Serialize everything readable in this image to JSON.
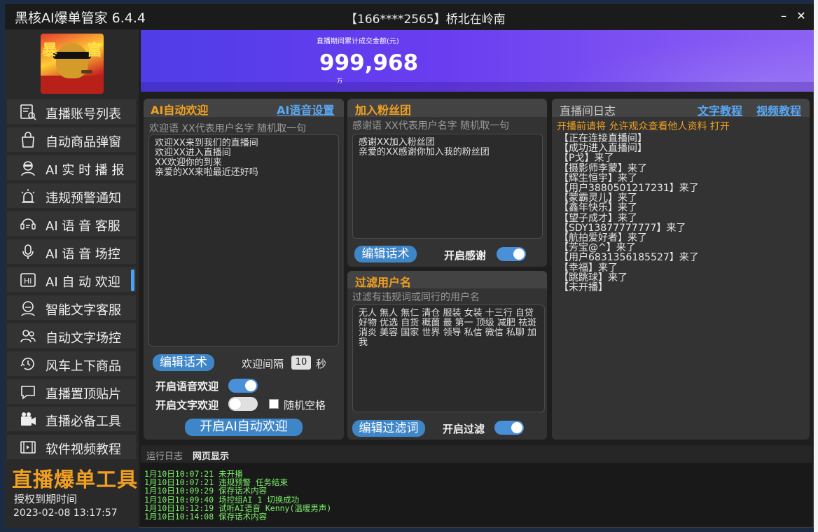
{
  "window": {
    "app_title": "黑核AI爆单管家 6.4.4",
    "user_info": "【166****2565】桥北在岭南",
    "minimize_label": "–",
    "close_label": "✕"
  },
  "sidebar": {
    "avatar_chars": [
      "暴",
      "富"
    ],
    "items": [
      {
        "label": "直播账号列表",
        "icon": "account-list-icon"
      },
      {
        "label": "自动商品弹窗",
        "icon": "shopping-bag-icon"
      },
      {
        "label": "AI 实 时 播 报",
        "icon": "broadcaster-icon"
      },
      {
        "label": "违规预警通知",
        "icon": "alarm-icon"
      },
      {
        "label": "AI 语 音 客服",
        "icon": "voice-service-icon"
      },
      {
        "label": "AI 语 音 场控",
        "icon": "microphone-icon"
      },
      {
        "label": "AI 自 动 欢迎",
        "icon": "hi-icon"
      },
      {
        "label": "智能文字客服",
        "icon": "text-service-icon"
      },
      {
        "label": "自动文字场控",
        "icon": "users-icon"
      },
      {
        "label": "风车上下商品",
        "icon": "windmill-icon"
      },
      {
        "label": "直播置顶贴片",
        "icon": "pin-message-icon"
      },
      {
        "label": "直播必备工具",
        "icon": "camera-tool-icon"
      },
      {
        "label": "软件视频教程",
        "icon": "video-tutorial-icon"
      }
    ],
    "active_index": 6,
    "brand": "直播爆单工具",
    "auth_label": "授权到期时间",
    "auth_date": "2023-02-08 13:17:57"
  },
  "banner": {
    "caption": "直播期间累计成交金额(元)",
    "amount": "999,968",
    "unit": "万"
  },
  "welcome_panel": {
    "title": "AI自动欢迎",
    "voice_link": "AI语音设置",
    "hint": "欢迎语  XX代表用户名字  随机取一句",
    "text": "欢迎XX来到我们的直播间\n欢迎XX进入直播间\nXX欢迎你的到来\n亲爱的XX来啦最近还好吗",
    "edit_button": "编辑话术",
    "interval_label": "欢迎间隔",
    "interval_value": "10",
    "interval_unit": "秒",
    "voice_toggle_label": "开启语音欢迎",
    "voice_toggle_on": true,
    "text_toggle_label": "开启文字欢迎",
    "text_toggle_on": false,
    "random_space_label": "随机空格",
    "start_button": "开启AI自动欢迎"
  },
  "fan_panel": {
    "title": "加入粉丝团",
    "hint": "感谢语  XX代表用户名字  随机取一句",
    "text": "感谢XX加入粉丝团\n亲爱的XX感谢你加入我的粉丝团",
    "edit_button": "编辑话术",
    "thanks_toggle_label": "开启感谢",
    "thanks_toggle_on": true
  },
  "filter_panel": {
    "title": "过滤用户名",
    "hint": "过滤有违规词或同行的用户名",
    "text": "无人 無人 無仁 清仓 服装 女装 十三行 自贷 好物 优选 自货 穊薗 最 第一 顶级 减肥 祛斑 消炎 美容 国家 世界 领导 私信 微信 私聊 加我",
    "edit_button": "编辑过滤词",
    "filter_toggle_label": "开启过滤",
    "filter_toggle_on": true
  },
  "log_panel": {
    "title": "直播间日志",
    "text_tutorial": "文字教程",
    "video_tutorial": "视频教程",
    "warning": "开播前请将 允许观众查看他人资料 打开",
    "lines": [
      "【正在连接直播间】",
      "【成功进入直播间】",
      "【P戈】来了",
      "【摄影师李蒙】来了",
      "【辉生恒宇】来了",
      "【用户3880501217231】来了",
      "【蒙霸灵儿】来了",
      "【鑫年快乐】来了",
      "【望子成才】来了",
      "【SDY13877777777】来了",
      "【航拍爱好者】来了",
      "【芳宝@^】来了",
      "【用户6831356185527】来了",
      "【幸福】来了",
      "【跳跳球】来了",
      "【未开播】"
    ]
  },
  "bottom": {
    "tab_run_log": "运行日志",
    "tab_web": "网页显示",
    "run_lines": [
      "1月10日10:07:21 未开播",
      "1月10日10:07:21 违规预警 任务结束",
      "1月10日10:09:29 保存话术内容",
      "1月10日10:09:40 场控组AI 1 切换成功",
      "1月10日10:12:19 试听AI语音 Kenny(温暖男声)",
      "1月10日10:14:08 保存话术内容"
    ]
  },
  "colors": {
    "accent_orange": "#f0a020",
    "accent_blue": "#3f86c8",
    "log_green": "#7cf06a",
    "banner_purple": "#6a3df0"
  }
}
